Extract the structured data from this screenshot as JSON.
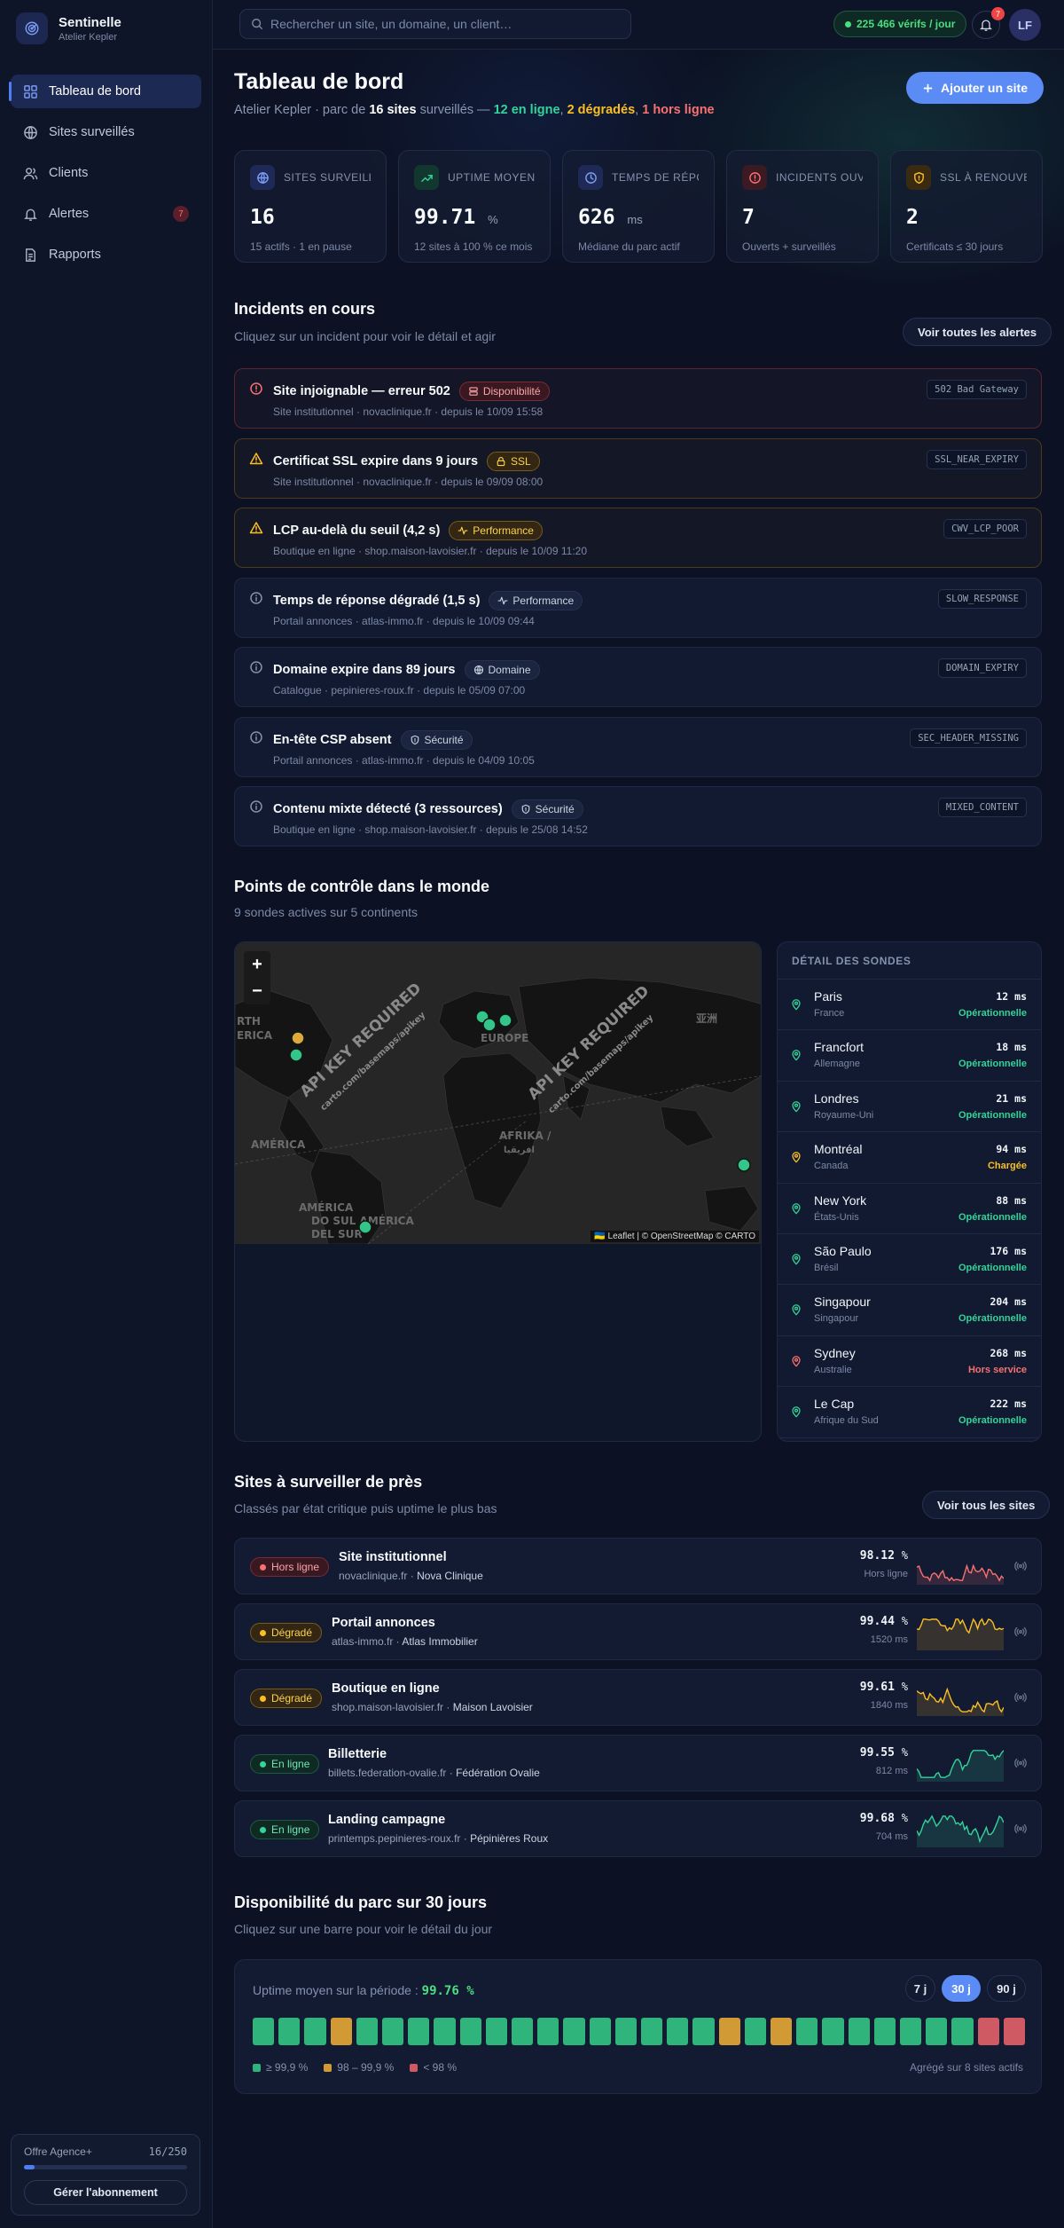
{
  "brand": {
    "name": "Sentinelle",
    "sub": "Atelier Kepler"
  },
  "nav": [
    {
      "label": "Tableau de bord",
      "icon": "dashboard-icon"
    },
    {
      "label": "Sites surveillés",
      "icon": "globe-icon"
    },
    {
      "label": "Clients",
      "icon": "users-icon"
    },
    {
      "label": "Alertes",
      "icon": "bell-icon",
      "badge": "7"
    },
    {
      "label": "Rapports",
      "icon": "document-icon"
    }
  ],
  "plan": {
    "name": "Offre Agence+",
    "usage": "16/250",
    "fill": 0.064,
    "button": "Gérer l'abonnement"
  },
  "topbar": {
    "search_placeholder": "Rechercher un site, un domaine, un client…",
    "checks": "225 466 vérifs / jour",
    "notif_count": "7",
    "avatar": "LF"
  },
  "header": {
    "title": "Tableau de bord",
    "sub_prefix": "Atelier Kepler · parc de ",
    "sub_sites": "16 sites",
    "sub_mid": " surveillés — ",
    "online": "12 en ligne",
    "sep1": ", ",
    "degraded": "2 dégradés",
    "sep2": ", ",
    "offline": "1 hors ligne",
    "add_button": "Ajouter un site"
  },
  "stats": [
    {
      "label": "SITES SURVEILLÉS",
      "value": "16",
      "unit": "",
      "note": "15 actifs · 1 en pause",
      "icon": "globe-icon",
      "color": "#7c9cf5",
      "bg": "#1e2a55"
    },
    {
      "label": "UPTIME MOYEN",
      "value": "99.71",
      "unit": "%",
      "note": "12 sites à 100 % ce mois",
      "icon": "trend-up-icon",
      "color": "#34d399",
      "bg": "#12372e"
    },
    {
      "label": "TEMPS DE RÉPONSE",
      "value": "626",
      "unit": "ms",
      "note": "Médiane du parc actif",
      "icon": "clock-icon",
      "color": "#7c9cf5",
      "bg": "#1e2a55"
    },
    {
      "label": "INCIDENTS OUVERTS",
      "value": "7",
      "unit": "",
      "note": "Ouverts + surveillés",
      "icon": "alert-circle-icon",
      "color": "#f87171",
      "bg": "#3b1a24"
    },
    {
      "label": "SSL À RENOUVELER",
      "value": "2",
      "unit": "",
      "note": "Certificats ≤ 30 jours",
      "icon": "shield-icon",
      "color": "#fbbf24",
      "bg": "#3a2a12"
    }
  ],
  "incidents_section": {
    "title": "Incidents en cours",
    "sub": "Cliquez sur un incident pour voir le détail et agir",
    "button": "Voir toutes les alertes"
  },
  "incidents": [
    {
      "title": "Site injoignable — erreur 502",
      "tag": "Disponibilité",
      "tag_icon": "server-icon",
      "level": "crit",
      "meta": "Site institutionnel · novaclinique.fr · depuis le 10/09 15:58",
      "code": "502 Bad Gateway"
    },
    {
      "title": "Certificat SSL expire dans 9 jours",
      "tag": "SSL",
      "tag_icon": "lock-icon",
      "level": "warn",
      "meta": "Site institutionnel · novaclinique.fr · depuis le 09/09 08:00",
      "code": "SSL_NEAR_EXPIRY"
    },
    {
      "title": "LCP au-delà du seuil (4,2 s)",
      "tag": "Performance",
      "tag_icon": "activity-icon",
      "level": "warn",
      "meta": "Boutique en ligne · shop.maison-lavoisier.fr · depuis le 10/09 11:20",
      "code": "CWV_LCP_POOR"
    },
    {
      "title": "Temps de réponse dégradé (1,5 s)",
      "tag": "Performance",
      "tag_icon": "activity-icon",
      "level": "info",
      "meta": "Portail annonces · atlas-immo.fr · depuis le 10/09 09:44",
      "code": "SLOW_RESPONSE"
    },
    {
      "title": "Domaine expire dans 89 jours",
      "tag": "Domaine",
      "tag_icon": "globe-icon",
      "level": "info",
      "meta": "Catalogue · pepinieres-roux.fr · depuis le 05/09 07:00",
      "code": "DOMAIN_EXPIRY"
    },
    {
      "title": "En-tête CSP absent",
      "tag": "Sécurité",
      "tag_icon": "shield-icon",
      "level": "info",
      "meta": "Portail annonces · atlas-immo.fr · depuis le 04/09 10:05",
      "code": "SEC_HEADER_MISSING"
    },
    {
      "title": "Contenu mixte détecté (3 ressources)",
      "tag": "Sécurité",
      "tag_icon": "shield-icon",
      "level": "info",
      "meta": "Boutique en ligne · shop.maison-lavoisier.fr · depuis le 25/08 14:52",
      "code": "MIXED_CONTENT"
    }
  ],
  "map_section": {
    "title": "Points de contrôle dans le monde",
    "sub": "9 sondes actives sur 5 continents"
  },
  "map": {
    "watermark": "API KEY REQUIRED",
    "watermark_sub": "carto.com/basemaps/apikey",
    "zoom_in": "+",
    "zoom_out": "−",
    "attribution": "🇺🇦 Leaflet | © OpenStreetMap © CARTO",
    "labels": [
      "RTH",
      "ERICA",
      "EUROPE",
      "AMÉRICA",
      "AFRIKA /",
      "AMÉRICA",
      "DO SUL AMÉRICA",
      "DEL SUR",
      "亚洲",
      "افريقيا"
    ]
  },
  "probes_head": "DÉTAIL DES SONDES",
  "probes": [
    {
      "city": "Paris",
      "country": "France",
      "ms": "12 ms",
      "status": "Opérationnelle",
      "color": "#34d399"
    },
    {
      "city": "Francfort",
      "country": "Allemagne",
      "ms": "18 ms",
      "status": "Opérationnelle",
      "color": "#34d399"
    },
    {
      "city": "Londres",
      "country": "Royaume-Uni",
      "ms": "21 ms",
      "status": "Opérationnelle",
      "color": "#34d399"
    },
    {
      "city": "Montréal",
      "country": "Canada",
      "ms": "94 ms",
      "status": "Chargée",
      "color": "#fbbf24"
    },
    {
      "city": "New York",
      "country": "États-Unis",
      "ms": "88 ms",
      "status": "Opérationnelle",
      "color": "#34d399"
    },
    {
      "city": "São Paulo",
      "country": "Brésil",
      "ms": "176 ms",
      "status": "Opérationnelle",
      "color": "#34d399"
    },
    {
      "city": "Singapour",
      "country": "Singapour",
      "ms": "204 ms",
      "status": "Opérationnelle",
      "color": "#34d399"
    },
    {
      "city": "Sydney",
      "country": "Australie",
      "ms": "268 ms",
      "status": "Hors service",
      "color": "#f87171"
    },
    {
      "city": "Le Cap",
      "country": "Afrique du Sud",
      "ms": "222 ms",
      "status": "Opérationnelle",
      "color": "#34d399"
    }
  ],
  "sites_section": {
    "title": "Sites à surveiller de près",
    "sub": "Classés par état critique puis uptime le plus bas",
    "button": "Voir tous les sites"
  },
  "sites": [
    {
      "status": "Hors ligne",
      "name": "Site institutionnel",
      "domain": "novaclinique.fr",
      "client": "Nova Clinique",
      "uptime": "98.12",
      "detail": "Hors ligne",
      "color": "#f87171",
      "kind": "red"
    },
    {
      "status": "Dégradé",
      "name": "Portail annonces",
      "domain": "atlas-immo.fr",
      "client": "Atlas Immobilier",
      "uptime": "99.44",
      "detail": "1520 ms",
      "color": "#fbbf24",
      "kind": "amber"
    },
    {
      "status": "Dégradé",
      "name": "Boutique en ligne",
      "domain": "shop.maison-lavoisier.fr",
      "client": "Maison Lavoisier",
      "uptime": "99.61",
      "detail": "1840 ms",
      "color": "#fbbf24",
      "kind": "amber"
    },
    {
      "status": "En ligne",
      "name": "Billetterie",
      "domain": "billets.federation-ovalie.fr",
      "client": "Fédération Ovalie",
      "uptime": "99.55",
      "detail": "812 ms",
      "color": "#34d399",
      "kind": "green"
    },
    {
      "status": "En ligne",
      "name": "Landing campagne",
      "domain": "printemps.pepinieres-roux.fr",
      "client": "Pépinières Roux",
      "uptime": "99.68",
      "detail": "704 ms",
      "color": "#34d399",
      "kind": "green"
    }
  ],
  "availability_section": {
    "title": "Disponibilité du parc sur 30 jours",
    "sub": "Cliquez sur une barre pour voir le détail du jour"
  },
  "availability": {
    "label": "Uptime moyen sur la période : ",
    "value": "99.76 %",
    "ranges": [
      "7 j",
      "30 j",
      "90 j"
    ],
    "active_range": "30 j",
    "days": [
      "g",
      "g",
      "g",
      "a",
      "g",
      "g",
      "g",
      "g",
      "g",
      "g",
      "g",
      "g",
      "g",
      "g",
      "g",
      "g",
      "g",
      "g",
      "a",
      "g",
      "a",
      "g",
      "g",
      "g",
      "g",
      "g",
      "g",
      "g",
      "r",
      "r"
    ],
    "legend": [
      "≥ 99,9 %",
      "98 – 99,9 %",
      "< 98 %"
    ],
    "note": "Agrégé sur 8 sites actifs",
    "colors": {
      "g": "#2fb57c",
      "a": "#d19a35",
      "r": "#d05a64"
    }
  }
}
